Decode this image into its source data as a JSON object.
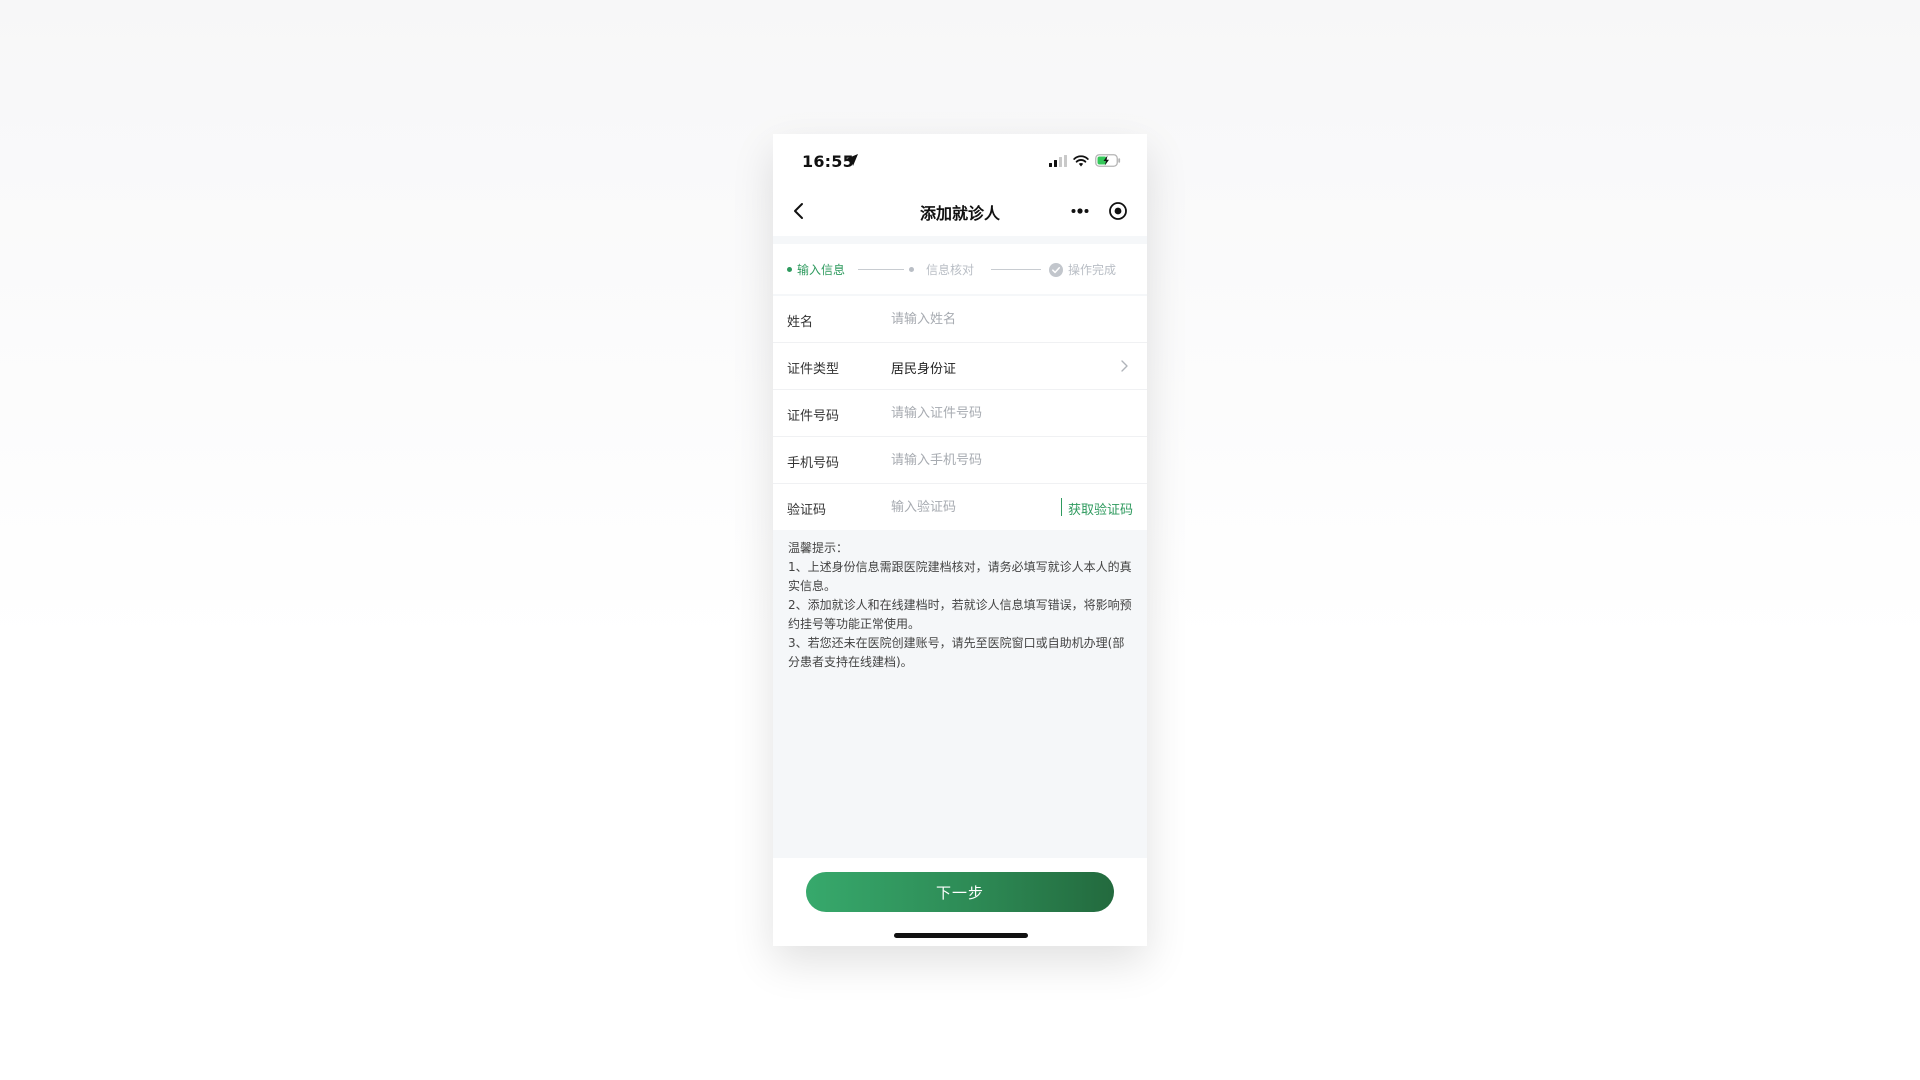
{
  "status_bar": {
    "time": "16:55",
    "icons": [
      "location-arrow-icon",
      "signal-icon",
      "wifi-icon",
      "battery-charging-icon"
    ]
  },
  "nav": {
    "title": "添加就诊人",
    "icons": [
      "back-icon",
      "more-icon",
      "close-target-icon"
    ]
  },
  "steps": [
    {
      "label": "输入信息",
      "state": "active"
    },
    {
      "label": "信息核对",
      "state": "pending"
    },
    {
      "label": "操作完成",
      "state": "pending"
    }
  ],
  "form": {
    "name": {
      "label": "姓名",
      "placeholder": "请输入姓名",
      "value": ""
    },
    "id_type": {
      "label": "证件类型",
      "value": "居民身份证"
    },
    "id_number": {
      "label": "证件号码",
      "placeholder": "请输入证件号码",
      "value": ""
    },
    "phone": {
      "label": "手机号码",
      "placeholder": "请输入手机号码",
      "value": ""
    },
    "code": {
      "label": "验证码",
      "placeholder": "输入验证码",
      "value": "",
      "button": "获取验证码"
    }
  },
  "tips": {
    "title": "温馨提示：",
    "lines": [
      "1、上述身份信息需跟医院建档核对，请务必填写就诊人本人的真实信息。",
      "2、添加就诊人和在线建档时，若就诊人信息填写错误，将影响预约挂号等功能正常使用。",
      "3、若您还未在医院创建账号，请先至医院窗口或自助机办理(部分患者支持在线建档)。"
    ]
  },
  "actions": {
    "next": "下一步"
  },
  "colors": {
    "accent": "#2e9a5e",
    "button_start": "#37a96c",
    "button_end": "#236a3e",
    "page_bg": "#f5f7f9",
    "placeholder": "#a7abb1"
  }
}
